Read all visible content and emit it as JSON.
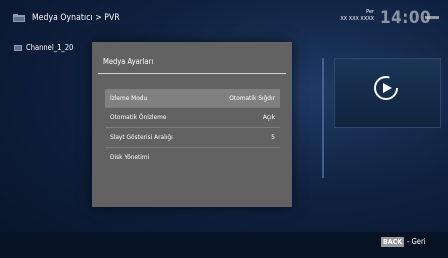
{
  "header": {
    "breadcrumb": "Medya Oynatıcı > PVR",
    "day": "Per",
    "date": "XX XXX XXXX",
    "clock": "14:00"
  },
  "file_list": [
    {
      "label": "Channel_1_20"
    }
  ],
  "dialog": {
    "title": "Medya Ayarları",
    "rows": [
      {
        "label": "İzleme Modu",
        "value": "Otomatik Sığdır"
      },
      {
        "label": "Otomatik Önizleme",
        "value": "Açık"
      },
      {
        "label": "Slayt Gösterisi Aralığı",
        "value": "5"
      },
      {
        "label": "Disk Yönetimi",
        "value": ""
      }
    ]
  },
  "footer": {
    "back_key": "BACK",
    "back_label": "- Geri"
  },
  "colors": {
    "background": "#0f2140",
    "dialog": "#626262",
    "selected_row": "#808080"
  },
  "icons": [
    "folder-icon",
    "file-icon",
    "play-icon"
  ]
}
